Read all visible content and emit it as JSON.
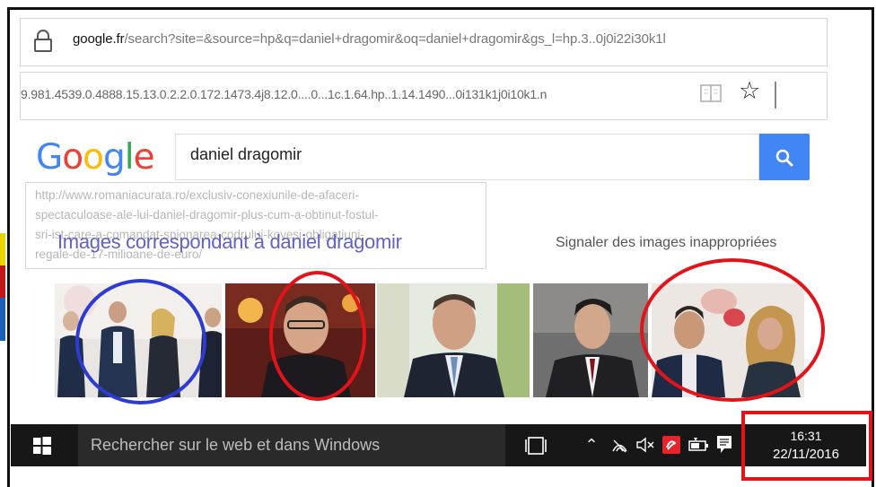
{
  "colors": {
    "accent_blue": "#4285f4",
    "heading_purple": "#6161c9",
    "taskbar": "#171717",
    "annotation_red": "#e2141a",
    "annotation_blue": "#2d3bd3"
  },
  "browser": {
    "lock_icon": "lock-icon",
    "url_domain": "google.fr",
    "url_path": "/search?site=&source=hp&q=daniel+dragomir&oq=daniel+dragomir&gs_l=hp.3..0j0i22i30k1l",
    "url_continuation": "9.981.4539.0.4888.15.13.0.2.2.0.172.1473.4j8.12.0....0...1c.1.64.hp..1.14.1490...0i131k1j0i10k1.n",
    "reading_view_icon": "reading-view-icon",
    "favorite_icon": "star-icon"
  },
  "google": {
    "logo": "Google",
    "search_value": "daniel dragomir",
    "search_icon": "search-icon"
  },
  "suggestion": {
    "lines": [
      "http://www.romaniacurata.ro/exclusiv-conexiunile-de-afaceri-",
      "spectaculoase-ale-lui-daniel-dragomir-plus-cum-a-obtinut-fostul-",
      "sri-ist-care-a-comandat-spionarea-codrului-kovesi-obligatiuni-",
      "regale-de-17-milioane-de-euro/"
    ]
  },
  "results": {
    "images_heading": "Images correspondant à daniel dragomir",
    "report_link": "Signaler des images inappropriées"
  },
  "taskbar": {
    "windows_icon": "windows-icon",
    "search_placeholder": "Rechercher sur le web et dans Windows",
    "task_view_icon": "task-view-icon",
    "tray_icons": [
      "chevron-up-icon",
      "wifi-icon",
      "volume-muted-icon",
      "app-red-icon",
      "battery-icon",
      "notifications-icon"
    ],
    "time": "16:31",
    "date": "22/11/2016"
  }
}
